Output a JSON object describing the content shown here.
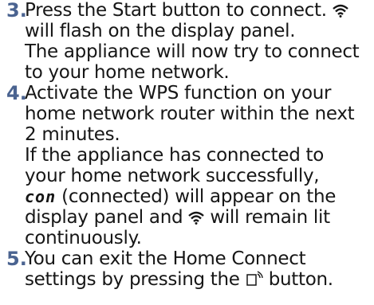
{
  "steps": [
    {
      "number": "3.",
      "lines": [
        "Press the Start button to connect.",
        "will flash on the display panel.",
        "The appliance will now try to connect",
        "to your home network."
      ]
    },
    {
      "number": "4.",
      "lines": [
        "Activate the WPS function on your",
        "home network router within the next",
        "2 minutes.",
        "If the appliance has connected to",
        "your home network successfully,",
        "con",
        "(connected) will appear on the",
        "display panel and",
        "will remain lit",
        "continuously."
      ]
    },
    {
      "number": "5.",
      "lines": [
        "You can exit the Home Connect",
        "settings by pressing the",
        "button."
      ]
    }
  ],
  "icons": {
    "wifi": "wifi-icon",
    "remote_start": "remote-start-icon"
  },
  "colors": {
    "step_number": "#4a6390",
    "text": "#161616"
  }
}
